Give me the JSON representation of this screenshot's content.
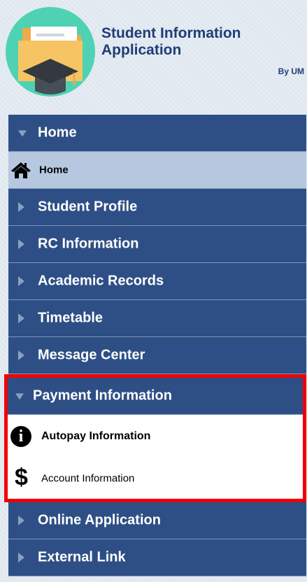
{
  "header": {
    "title": "Student Information Application",
    "by_line": "By UM",
    "logo_icon": "folder-graduation-cap-logo"
  },
  "menu": {
    "home_group_label": "Home",
    "home_item_label": "Home",
    "items": [
      {
        "label": "Student Profile"
      },
      {
        "label": "RC Information"
      },
      {
        "label": "Academic Records"
      },
      {
        "label": "Timetable"
      },
      {
        "label": "Message Center"
      }
    ],
    "payment_group_label": "Payment Information",
    "payment_items": [
      {
        "label": "Autopay Information",
        "icon": "info-icon"
      },
      {
        "label": "Account Information",
        "icon": "dollar-icon"
      }
    ],
    "items_after": [
      {
        "label": "Online Application"
      },
      {
        "label": "External Link"
      }
    ]
  },
  "colors": {
    "menu_dark": "#2e4f85",
    "menu_selected": "#b6c8e0",
    "highlight": "#f00006",
    "title": "#1f3d77"
  }
}
